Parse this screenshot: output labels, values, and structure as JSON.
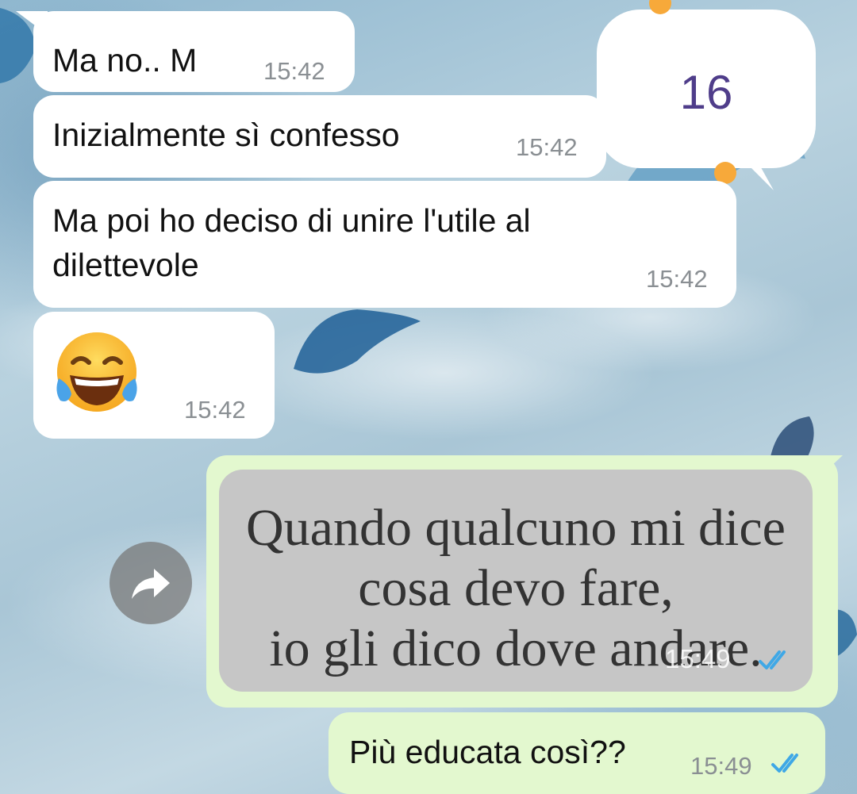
{
  "messages": [
    {
      "text": "Ma no.. M",
      "time": "15:42",
      "direction": "incoming"
    },
    {
      "text": "Inizialmente sì confesso",
      "time": "15:42",
      "direction": "incoming"
    },
    {
      "text_line1": "Ma poi ho deciso di unire l'utile al",
      "text_line2": "dilettevole",
      "time": "15:42",
      "direction": "incoming"
    },
    {
      "emoji": "face-with-tears-of-joy",
      "time": "15:42",
      "direction": "incoming"
    }
  ],
  "overlay_note": {
    "number": "16",
    "accent_color": "#4f3d8a",
    "dot_color": "#f7a93a"
  },
  "forwarded_image": {
    "lines": [
      "Quando qualcuno mi dice",
      "cosa devo fare,",
      "io gli dico dove andare."
    ],
    "time": "15:49",
    "status": "read"
  },
  "last_message": {
    "text": "Più educata così??",
    "time": "15:49",
    "status": "read"
  },
  "colors": {
    "incoming_bubble": "#ffffff",
    "outgoing_bubble": "#e3f8cf",
    "read_ticks": "#3fa8e6",
    "timestamp": "#8a8f93"
  },
  "icons": [
    "forward-icon",
    "double-check-icon",
    "face-with-tears-of-joy-icon"
  ]
}
